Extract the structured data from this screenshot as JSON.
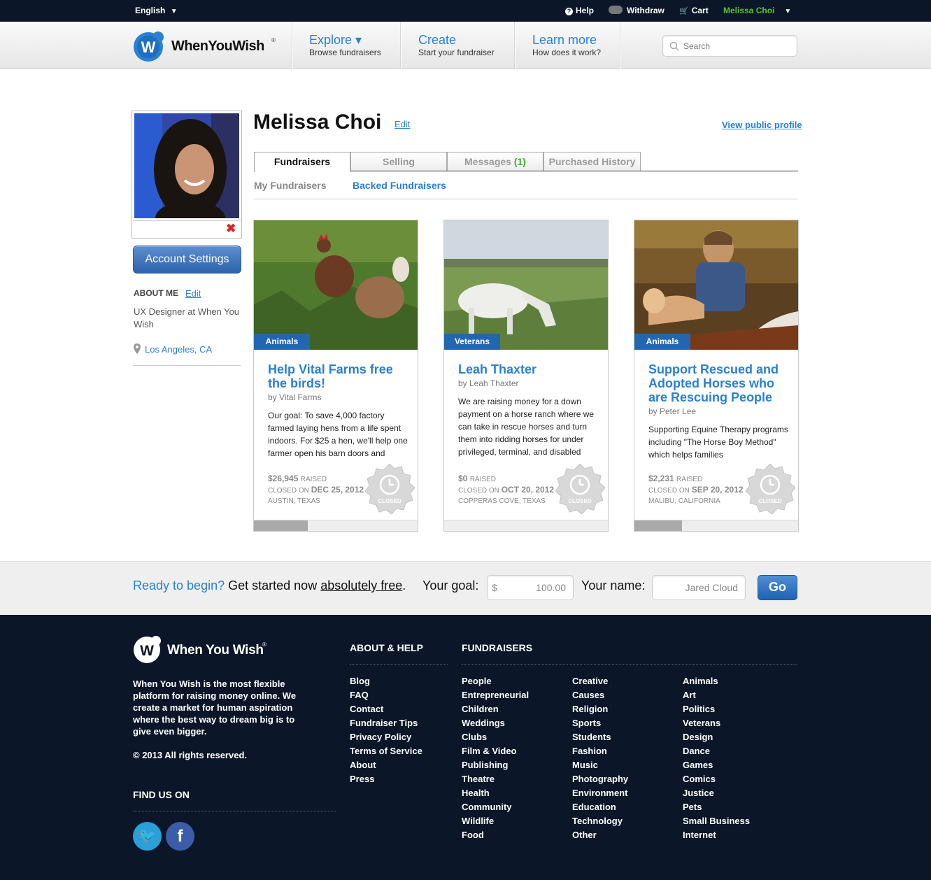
{
  "topbar": {
    "language": "English",
    "help": "Help",
    "withdraw": "Withdraw",
    "cart": "Cart",
    "user": "Melissa Choi"
  },
  "header": {
    "logo_text": "WhenYouWish",
    "nav": [
      {
        "title": "Explore ▾",
        "sub": "Browse fundraisers"
      },
      {
        "title": "Create",
        "sub": "Start your fundraiser"
      },
      {
        "title": "Learn more",
        "sub": "How does it work?"
      }
    ],
    "search_placeholder": "Search"
  },
  "sidebar": {
    "account_settings": "Account Settings",
    "about_label": "ABOUT ME",
    "about_edit": "Edit",
    "about_text": "UX Designer at When You Wish",
    "location": "Los Angeles, CA"
  },
  "profile": {
    "name": "Melissa Choi",
    "edit": "Edit",
    "view_public": "View public profile",
    "tabs": [
      {
        "label": "Fundraisers"
      },
      {
        "label": "Selling"
      },
      {
        "label": "Messages",
        "count": "(1)"
      },
      {
        "label": "Purchased History"
      }
    ],
    "subtabs": [
      "My Fundraisers",
      "Backed Fundraisers"
    ]
  },
  "cards": [
    {
      "category": "Animals",
      "title": "Help Vital Farms free the birds!",
      "by": "by Vital Farms",
      "desc": "Our goal: To save 4,000 factory farmed laying hens from a life spent indoors. For $25 a hen, we'll help one farmer open his barn doors and",
      "raised": "$26,945",
      "raised_label": "RAISED",
      "closed_label": "CLOSED ON",
      "closed_date": "DEC 25, 2012",
      "location": "AUSTIN, TEXAS",
      "seal": "CLOSED",
      "progress": 0.33
    },
    {
      "category": "Veterans",
      "title": "Leah Thaxter",
      "by": "by Leah Thaxter",
      "desc": "We are raising money for a down payment on a horse ranch where we can take in rescue horses and turn them into ridding horses for under privileged, terminal, and disabled",
      "raised": "$0",
      "raised_label": "RAISED",
      "closed_label": "CLOSED ON",
      "closed_date": "OCT 20, 2012",
      "location": "COPPERAS COVE, TEXAS",
      "seal": "CLOSED",
      "progress": 0
    },
    {
      "category": "Animals",
      "title": "Support Rescued and Adopted Horses who are Rescuing People",
      "by": "by Peter Lee",
      "desc": "Supporting Equine Therapy programs including \"The Horse Boy Method\" which helps families",
      "raised": "$2,231",
      "raised_label": "RAISED",
      "closed_label": "CLOSED ON",
      "closed_date": "SEP 20, 2012",
      "location": "MALIBU, CALIFORNIA",
      "seal": "CLOSED",
      "progress": 0.29
    }
  ],
  "cta": {
    "ready": "Ready to begin?",
    "get_started": "Get started now",
    "free": "absolutely free",
    "period": ".",
    "goal_label": "Your goal:",
    "currency": "$",
    "goal_value": "100.00",
    "name_label": "Your name:",
    "name_value": "Jared Cloud",
    "go": "Go"
  },
  "footer": {
    "logo_text": "When You Wish",
    "about": "When You Wish is the most flexible platform for raising money online. We create a market for human aspiration where the best way to dream big is to give even bigger.",
    "copyright": "© 2013 All rights reserved.",
    "find_us": "FIND US ON",
    "about_help_title": "ABOUT & HELP",
    "about_help": [
      "Blog",
      "FAQ",
      "Contact",
      "Fundraiser Tips",
      "Privacy Policy",
      "Terms of Service",
      "About",
      "Press"
    ],
    "fundraisers_title": "FUNDRAISERS",
    "col1": [
      "People",
      "Entrepreneurial",
      "Children",
      "Weddings",
      "Clubs",
      "Film & Video",
      "Publishing",
      "Theatre",
      "Health",
      "Community",
      "Wildlife",
      "Food"
    ],
    "col2": [
      "Creative",
      "Causes",
      "Religion",
      "Sports",
      "Students",
      "Fashion",
      "Music",
      "Photography",
      "Environment",
      "Education",
      "Technology",
      "Other"
    ],
    "col3": [
      "Animals",
      "Art",
      "Politics",
      "Veterans",
      "Design",
      "Dance",
      "Games",
      "Comics",
      "Justice",
      "Pets",
      "Small Business",
      "Internet"
    ]
  },
  "colors": {
    "accent": "#2a80d2",
    "dark_bg": "#0b1728",
    "user_green": "#59c430",
    "category_blue": "#2366b0"
  }
}
